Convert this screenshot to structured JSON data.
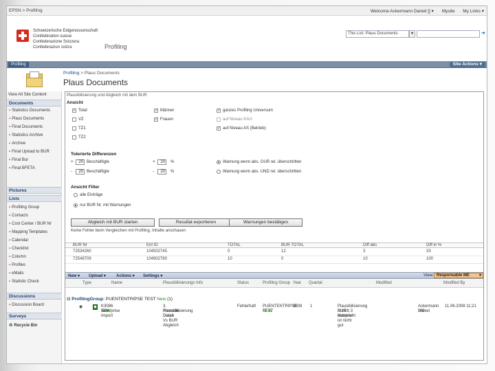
{
  "topbar": {
    "breadcrumb": "EPSN > Profiling",
    "welcome": "Welcome Ackermann Daniel [] ▾",
    "links": [
      "Mysite",
      "My Links ▾"
    ]
  },
  "header": {
    "confederation": [
      "Schweizerische Eidgenossenschaft",
      "Confédération suisse",
      "Confederazione Svizzera",
      "Confederaziun svizra"
    ],
    "site_title": "Profiling",
    "search_scope": "This List: Plaus Documents"
  },
  "navbar": {
    "tab": "Profiling",
    "site_actions": "Site Actions ▾"
  },
  "page": {
    "breadcrumb_link": "Profiling",
    "breadcrumb_current": "Plaus Documents",
    "title": "Plaus Documents"
  },
  "leftnav": {
    "view_all": "View All Site Content",
    "sections": [
      {
        "title": "Documents",
        "items": [
          "Statistics Documents",
          "Plaus Documents",
          "Final Documents",
          "Statistics Archive",
          "Archive",
          "Final Upload to BUR",
          "Final Bur",
          "Final BFETA"
        ]
      },
      {
        "title": "Pictures",
        "items": []
      },
      {
        "title": "Lists",
        "items": [
          "Profiling Group",
          "Contacts",
          "Cost Center / BUR Nr",
          "Mapping Templates",
          "Calendar",
          "Checklist",
          "Column",
          "Profiles",
          "eMails",
          "Statistic Check"
        ]
      },
      {
        "title": "Discussions",
        "items": [
          "Discussion Board"
        ]
      },
      {
        "title": "Surveys",
        "items": []
      }
    ],
    "recycle_bin": "Recycle Bin"
  },
  "content": {
    "intro": "Plausibilisierung und Abgleich mit dem BUR",
    "ansicht_title": "Ansicht",
    "checkboxes": [
      {
        "label": "Total",
        "checked": true,
        "dim": false
      },
      {
        "label": "VZ",
        "checked": false,
        "dim": false
      },
      {
        "label": "TZ1",
        "checked": false,
        "dim": false
      },
      {
        "label": "TZ2",
        "checked": false,
        "dim": false
      },
      {
        "label": "Männer",
        "checked": true,
        "dim": false
      },
      {
        "label": "Frauen",
        "checked": true,
        "dim": false
      },
      {
        "label": "ganzes Profiling Universum",
        "checked": true,
        "dim": false
      },
      {
        "label": "auf Niveau KAU",
        "checked": false,
        "dim": true
      },
      {
        "label": "auf Niveau AS (Betrieb)",
        "checked": true,
        "dim": false
      }
    ],
    "diff_title": "Tolerierte Differenzen",
    "diffs": [
      {
        "sign": "+",
        "abs": "20",
        "label": "Beschäftigte",
        "pct_sign": "+",
        "pct": "20",
        "unit": "%",
        "warning": "Warnung wenn abs. OUR rel. überschritten",
        "selected": true
      },
      {
        "sign": "-",
        "abs": "20",
        "label": "Beschäftigte",
        "pct_sign": "-",
        "pct": "20",
        "unit": "%",
        "warning": "Warnung wenn abs. UND rel. überschritten",
        "selected": false
      }
    ],
    "filter_title": "Ansicht Filter",
    "filters": [
      {
        "label": "alle Einträge",
        "selected": false
      },
      {
        "label": "nur BUR Nr. mit Warnungen",
        "selected": true
      }
    ],
    "buttons": [
      "Abgleich mit BUR starten",
      "Resultat exportieren",
      "Warnungen bestätigen"
    ],
    "note": "Keine Fehler beim Vergleichen mit Profiling, Inhalte anschauen",
    "table_headers": [
      "BUR Nr",
      "Ent ID",
      "TOTAL",
      "BUR TOTAL",
      "Diff abs",
      "Diff in %"
    ],
    "table_rows": [
      [
        "72534260",
        "104502745",
        "0",
        "12",
        "3",
        "33"
      ],
      [
        "72548709",
        "104902760",
        "10",
        "0",
        "10",
        "100"
      ]
    ]
  },
  "toolbar": {
    "items": [
      "New ▾",
      "Upload ▾",
      "Actions ▾",
      "Settings ▾"
    ],
    "view_label": "View:",
    "view_value": "Responsable ME"
  },
  "list": {
    "headers": [
      "Type",
      "Name",
      "Plausibilisierungs Info",
      "Status",
      "Profiling Group",
      "Year",
      "Quartal",
      "Modified",
      "Modified By"
    ],
    "group_label": "ProfilingGroup",
    "group_value": ": PUENTENTRIPSE TEST",
    "group_new": "New",
    "group_count": "(1)",
    "row": {
      "name": [
        "K3086 Enterprise",
        "Test Import"
      ],
      "new_tag": "NEW",
      "info": [
        "3. Kontrolle Detail Vs BUR Abgleich",
        "Plausibilisierung Daten"
      ],
      "status": "Fehlerhaft",
      "group": [
        "PUENTENTRIPSE",
        "TEST"
      ],
      "group_new": "NEW",
      "year": "2008",
      "quartal": "1",
      "modified": [
        "Plausibilisierung Schritt 3 entspricht",
        "BUR Nummer ist nicht gut"
      ],
      "modified_by": [
        "Ackermann Daniel",
        "BfS"
      ],
      "date": [
        "11.06.2008 11:21"
      ]
    }
  }
}
